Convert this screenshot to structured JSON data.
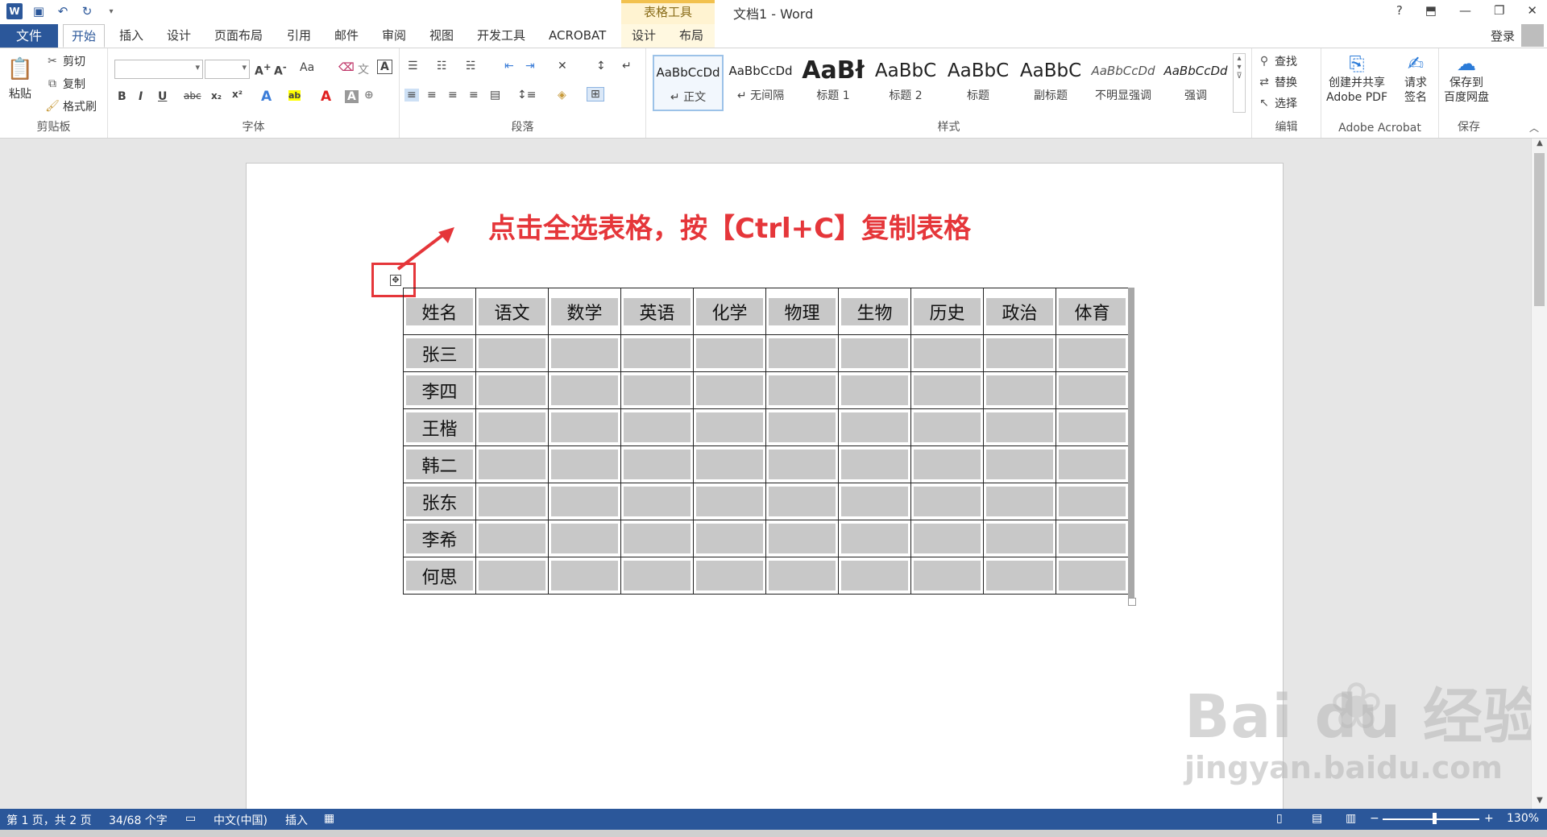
{
  "titlebar": {
    "context_tools": "表格工具",
    "doc_title": "文档1 - Word",
    "quick_access_icons": [
      "word-logo",
      "save-icon",
      "undo-icon",
      "redo-icon",
      "customize-icon"
    ],
    "window_controls": [
      "?",
      "⬒",
      "—",
      "❐",
      "✕"
    ]
  },
  "tabs": {
    "file": "文件",
    "items": [
      "开始",
      "插入",
      "设计",
      "页面布局",
      "引用",
      "邮件",
      "审阅",
      "视图",
      "开发工具",
      "ACROBAT",
      "设计",
      "布局"
    ],
    "active_index": 0,
    "login": "登录"
  },
  "ribbon": {
    "clipboard": {
      "paste": "粘贴",
      "cut": "剪切",
      "copy": "复制",
      "format_painter": "格式刷",
      "label": "剪贴板"
    },
    "font": {
      "label": "字体",
      "family_value": "",
      "size_value": "",
      "case_label": "Aa"
    },
    "paragraph": {
      "label": "段落"
    },
    "styles": {
      "label": "样式",
      "items": [
        {
          "sample": "AaBbCcDd",
          "name": "↵ 正文"
        },
        {
          "sample": "AaBbCcDd",
          "name": "↵ 无间隔"
        },
        {
          "sample": "AaBł",
          "name": "标题 1"
        },
        {
          "sample": "AaBbC",
          "name": "标题 2"
        },
        {
          "sample": "AaBbC",
          "name": "标题"
        },
        {
          "sample": "AaBbC",
          "name": "副标题"
        },
        {
          "sample": "AaBbCcDd",
          "name": "不明显强调"
        },
        {
          "sample": "AaBbCcDd",
          "name": "强调"
        }
      ]
    },
    "editing": {
      "find": "查找",
      "replace": "替换",
      "select": "选择",
      "label": "编辑"
    },
    "acrobat": {
      "create_pdf": "创建并共享",
      "create_pdf2": "Adobe PDF",
      "sign": "请求",
      "sign2": "签名",
      "label": "Adobe Acrobat"
    },
    "save": {
      "save_to": "保存到",
      "save_to2": "百度网盘",
      "label": "保存"
    }
  },
  "document": {
    "annotation": "点击全选表格，按【Ctrl+C】复制表格",
    "annotation_color": "#e5363a",
    "table": {
      "headers": [
        "姓名",
        "语文",
        "数学",
        "英语",
        "化学",
        "物理",
        "生物",
        "历史",
        "政治",
        "体育"
      ],
      "rows": [
        [
          "张三",
          "",
          "",
          "",
          "",
          "",
          "",
          "",
          "",
          ""
        ],
        [
          "李四",
          "",
          "",
          "",
          "",
          "",
          "",
          "",
          "",
          ""
        ],
        [
          "王楷",
          "",
          "",
          "",
          "",
          "",
          "",
          "",
          "",
          ""
        ],
        [
          "韩二",
          "",
          "",
          "",
          "",
          "",
          "",
          "",
          "",
          ""
        ],
        [
          "张东",
          "",
          "",
          "",
          "",
          "",
          "",
          "",
          "",
          ""
        ],
        [
          "李希",
          "",
          "",
          "",
          "",
          "",
          "",
          "",
          "",
          ""
        ],
        [
          "何思",
          "",
          "",
          "",
          "",
          "",
          "",
          "",
          "",
          ""
        ]
      ]
    }
  },
  "statusbar": {
    "page": "第 1 页，共 2 页",
    "words": "34/68 个字",
    "language": "中文(中国)",
    "mode": "插入",
    "zoom": "130%"
  },
  "watermark": {
    "main": "Bai du 经验",
    "sub": "jingyan.baidu.com"
  },
  "colors": {
    "brand": "#2b579a",
    "selection_gray": "#c8c8c8"
  }
}
